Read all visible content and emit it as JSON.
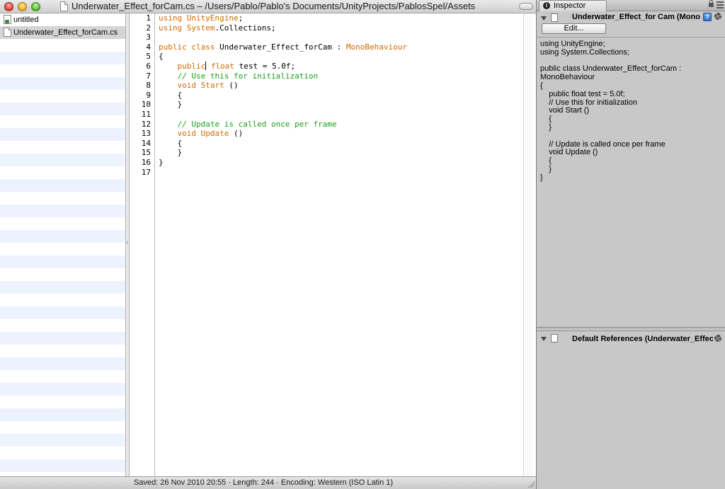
{
  "window": {
    "title": "Underwater_Effect_forCam.cs – /Users/Pablo/Pablo's Documents/UnityProjects/PablosSpel/Assets"
  },
  "sidebar": {
    "items": [
      {
        "label": "untitled"
      },
      {
        "label": "Underwater_Effect_forCam.cs"
      }
    ]
  },
  "editor": {
    "line_numbers": [
      "1",
      "2",
      "3",
      "4",
      "5",
      "6",
      "7",
      "8",
      "9",
      "10",
      "11",
      "12",
      "13",
      "14",
      "15",
      "16",
      "17"
    ]
  },
  "status": {
    "text": "Saved: 26 Nov 2010 20:55  ·  Length: 244  ·  Encoding: Western (ISO Latin 1)"
  },
  "inspector": {
    "tab_label": "Inspector",
    "tab_icon_glyph": "i",
    "header_title": "Underwater_Effect_for Cam (Mono",
    "help_glyph": "?",
    "edit_button": "Edit...",
    "preview_lines": [
      "using UnityEngine;",
      "using System.Collections;",
      "",
      "public class Underwater_Effect_forCam :",
      "MonoBehaviour",
      "{",
      "    public float test = 5.0f;",
      "    // Use this for initialization",
      "    void Start ()",
      "    {",
      "    }",
      "",
      "    // Update is called once per frame",
      "    void Update ()",
      "    {",
      "    }",
      "}"
    ],
    "default_refs_title": "Default References (Underwater_Effect"
  },
  "colors": {
    "keyword": "#d16a00",
    "comment": "#1aa31a",
    "sidebar_stripe": "#edf3fe",
    "inspector_bg": "#c8c8c8"
  },
  "icons": {
    "close": "close-window-icon",
    "minimize": "minimize-window-icon",
    "zoom": "zoom-window-icon",
    "lock": "lock-icon",
    "help": "help-icon",
    "gear": "gear-icon"
  }
}
